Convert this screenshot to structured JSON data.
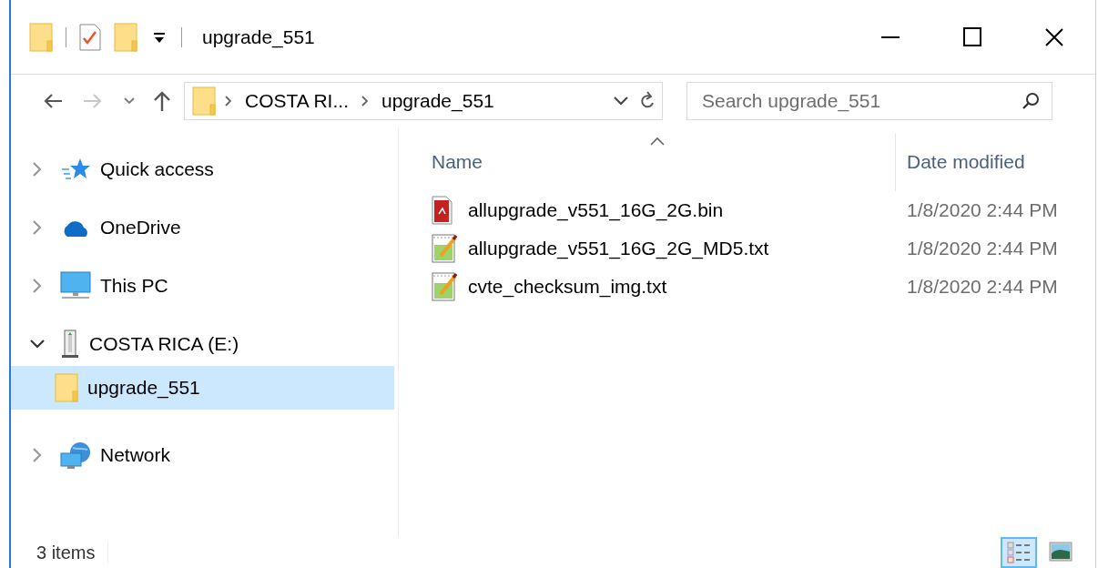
{
  "window": {
    "title": "upgrade_551"
  },
  "address": {
    "crumbs": [
      "COSTA RI...",
      "upgrade_551"
    ]
  },
  "search": {
    "placeholder": "Search upgrade_551"
  },
  "sidebar": {
    "items": [
      {
        "label": "Quick access",
        "kind": "star",
        "expanded": false,
        "selected": false
      },
      {
        "label": "OneDrive",
        "kind": "cloud",
        "expanded": false,
        "selected": false
      },
      {
        "label": "This PC",
        "kind": "pc",
        "expanded": false,
        "selected": false
      },
      {
        "label": "COSTA RICA (E:)",
        "kind": "drive",
        "expanded": true,
        "selected": false,
        "children": [
          {
            "label": "upgrade_551",
            "kind": "folder",
            "selected": true
          }
        ]
      },
      {
        "label": "Network",
        "kind": "network",
        "expanded": false,
        "selected": false
      }
    ]
  },
  "table": {
    "columns": [
      "Name",
      "Date modified"
    ],
    "rows": [
      {
        "name": "allupgrade_v551_16G_2G.bin",
        "kind": "pdf",
        "date": "1/8/2020 2:44 PM"
      },
      {
        "name": "allupgrade_v551_16G_2G_MD5.txt",
        "kind": "text",
        "date": "1/8/2020 2:44 PM"
      },
      {
        "name": "cvte_checksum_img.txt",
        "kind": "text",
        "date": "1/8/2020 2:44 PM"
      }
    ]
  },
  "status_bar": {
    "count": "3 items",
    "views": [
      {
        "kind": "details",
        "selected": true
      },
      {
        "kind": "tiles",
        "selected": false
      }
    ]
  }
}
